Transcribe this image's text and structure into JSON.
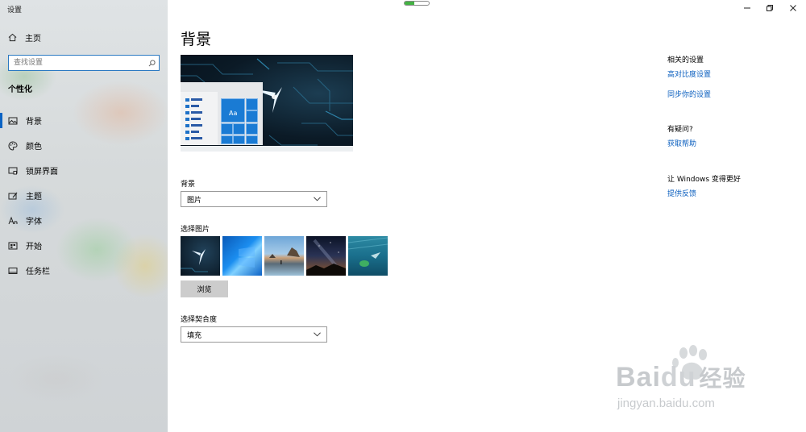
{
  "app": {
    "title": "设置"
  },
  "sidebar": {
    "home_label": "主页",
    "search_placeholder": "查找设置",
    "section_title": "个性化",
    "items": [
      {
        "label": "背景",
        "icon": "picture-icon",
        "active": true
      },
      {
        "label": "颜色",
        "icon": "palette-icon",
        "active": false
      },
      {
        "label": "锁屏界面",
        "icon": "lock-screen-icon",
        "active": false
      },
      {
        "label": "主题",
        "icon": "theme-icon",
        "active": false
      },
      {
        "label": "字体",
        "icon": "font-icon",
        "active": false
      },
      {
        "label": "开始",
        "icon": "start-icon",
        "active": false
      },
      {
        "label": "任务栏",
        "icon": "taskbar-icon",
        "active": false
      }
    ]
  },
  "window_controls": {
    "minimize": "minimize-icon",
    "maximize": "restore-icon",
    "close": "close-icon",
    "loading_progress": 0.4
  },
  "main": {
    "title": "背景",
    "preview": {
      "tile_label": "Aa"
    },
    "background_label": "背景",
    "background_value": "图片",
    "choose_picture_label": "选择图片",
    "browse_label": "浏览",
    "fit_label": "选择契合度",
    "fit_value": "填充"
  },
  "right": {
    "related_title": "相关的设置",
    "links": [
      "高对比度设置",
      "同步你的设置"
    ],
    "question_title": "有疑问?",
    "help_link": "获取帮助",
    "improve_title": "让 Windows 变得更好",
    "feedback_link": "提供反馈"
  },
  "watermark": {
    "brand": "Bai",
    "brand2": "du",
    "cn": "经验",
    "url": "jingyan.baidu.com"
  },
  "colors": {
    "accent": "#0b63c4",
    "link": "#0b5fbf",
    "search_border": "#2b79c2"
  }
}
